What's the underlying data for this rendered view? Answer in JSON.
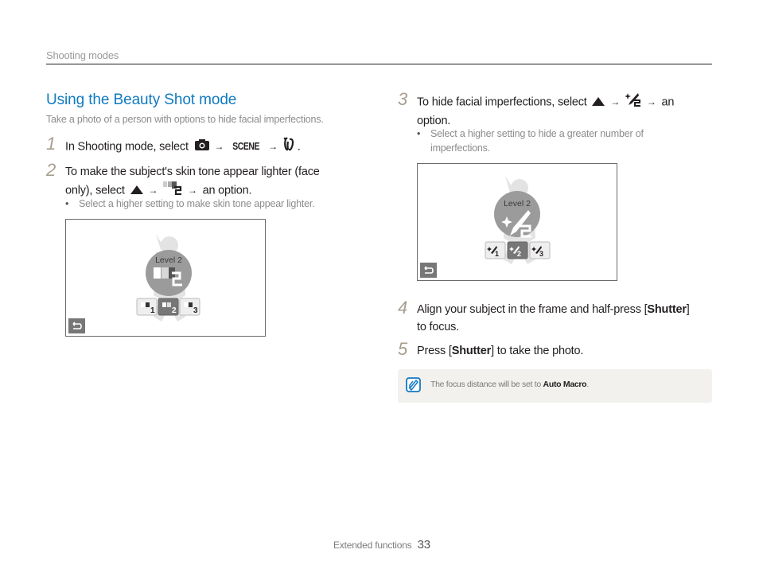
{
  "header": {
    "running_head": "Shooting modes"
  },
  "section": {
    "title": "Using the Beauty Shot mode",
    "subtitle": "Take a photo of a person with options to hide facial imperfections."
  },
  "steps": [
    {
      "num": "1",
      "text_a": "In Shooting mode, select",
      "icon_1": "camera-icon",
      "icon_2_label": "SCENE",
      "icon_3": "beauty-shot-icon",
      "text_b": "."
    },
    {
      "num": "2",
      "text_a": "To make the subject's skin tone appear lighter (face",
      "text_b": "only), select",
      "icon_1": "up-triangle-icon",
      "icon_2": "face-tone-icon",
      "text_c": "an option.",
      "bullet": "Select a higher setting to make skin tone appear lighter."
    },
    {
      "num": "3",
      "text_a": "To hide facial imperfections, select",
      "icon_1": "up-triangle-icon",
      "icon_2": "face-retouch-icon",
      "text_b": "an",
      "text_c": "option.",
      "bullet_a": "Select a higher setting to hide a greater number of",
      "bullet_b": "imperfections."
    },
    {
      "num": "4",
      "text_a": "Align your subject in the frame and half-press [",
      "bold": "Shutter",
      "text_b": "]",
      "text_c": "to focus."
    },
    {
      "num": "5",
      "text_a": "Press [",
      "bold": "Shutter",
      "text_b": "] to take the photo."
    }
  ],
  "arrow": "→",
  "screen_face_tone": {
    "level_label": "Level 2",
    "options": [
      "1",
      "2",
      "3"
    ],
    "selected": 2
  },
  "screen_retouch": {
    "level_label": "Level 2",
    "options": [
      "1",
      "2",
      "3"
    ],
    "selected": 2
  },
  "note": {
    "text": "The focus distance will be set to ",
    "bold": "Auto Macro",
    "end": "."
  },
  "footer": {
    "section": "Extended functions",
    "page": "33"
  },
  "colors": {
    "accent": "#0f7ac0",
    "step_number": "#a79e8e",
    "note_bg": "#f3f1ee"
  }
}
